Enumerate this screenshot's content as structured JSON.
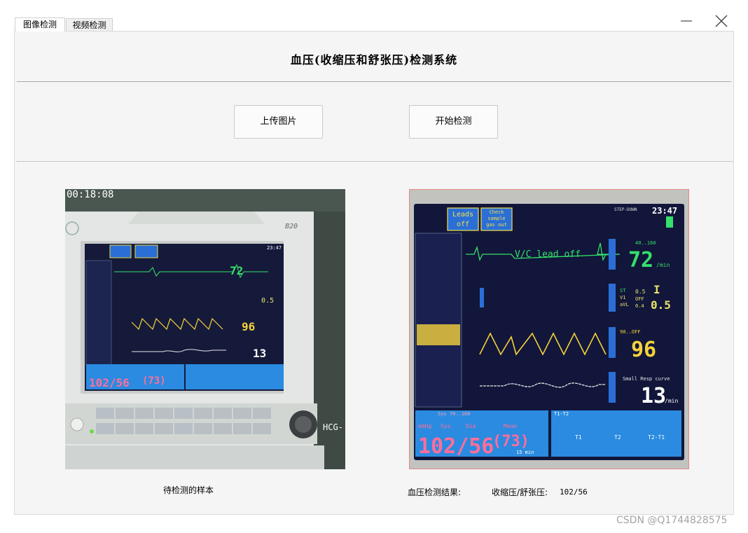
{
  "tabs": [
    {
      "label": "图像检测",
      "active": true
    },
    {
      "label": "视频检测",
      "active": false
    }
  ],
  "window_controls": {
    "minimize_icon": "minus-icon",
    "close_icon": "close-icon"
  },
  "header": {
    "title": "血压(收缩压和舒张压)检测系统"
  },
  "buttons": {
    "upload": "上传图片",
    "detect": "开始检测"
  },
  "left_panel": {
    "caption": "待检测的样本",
    "overlay_time": "00:18:08",
    "device_model": "B20",
    "side_label": "HCG-"
  },
  "right_panel": {
    "result_label": "血压检测结果:",
    "result_key": "收缩压/舒张压:",
    "result_value": "102/56"
  },
  "monitor": {
    "time": "23:47",
    "status": "STEP-DOWN",
    "alarm1": [
      "Leads",
      "off"
    ],
    "alarm2": [
      "Check",
      "sample",
      "gas out"
    ],
    "ecg_lead_text": "V/C lead off",
    "ecg_limits": "40..160",
    "hr": "72",
    "hr_unit": "/min",
    "st_rows": [
      [
        "ST",
        "I",
        "0.5"
      ],
      [
        "V1",
        "OFF",
        ""
      ],
      [
        "aVL",
        "0.4",
        "0.5"
      ]
    ],
    "st_main": "I",
    "st_val": "0.5",
    "spo2_limits": "90..OFF",
    "spo2": "96",
    "resp_label": "Small Resp curve",
    "resp": "13",
    "resp_unit": "/min",
    "nibp_header": "Sys 70..160",
    "nibp_unit": "mmHg",
    "nibp_labels": [
      "Sys",
      "Dia",
      "Mean"
    ],
    "nibp": "102/56",
    "mean": "(73)",
    "nibp_ago": "15 min",
    "t_header": "T1-T2",
    "t_labels": [
      "T1",
      "T2",
      "T2-T1"
    ]
  },
  "watermark": "CSDN @Q1744828575",
  "colors": {
    "panel_bg": "#f5f5f5",
    "screen_bg": "#151a3a",
    "ecg_green": "#35e06a",
    "spo2_yellow": "#f5d23c",
    "nibp_blue": "#2a8be0",
    "nibp_pink": "#ff6e9a"
  }
}
